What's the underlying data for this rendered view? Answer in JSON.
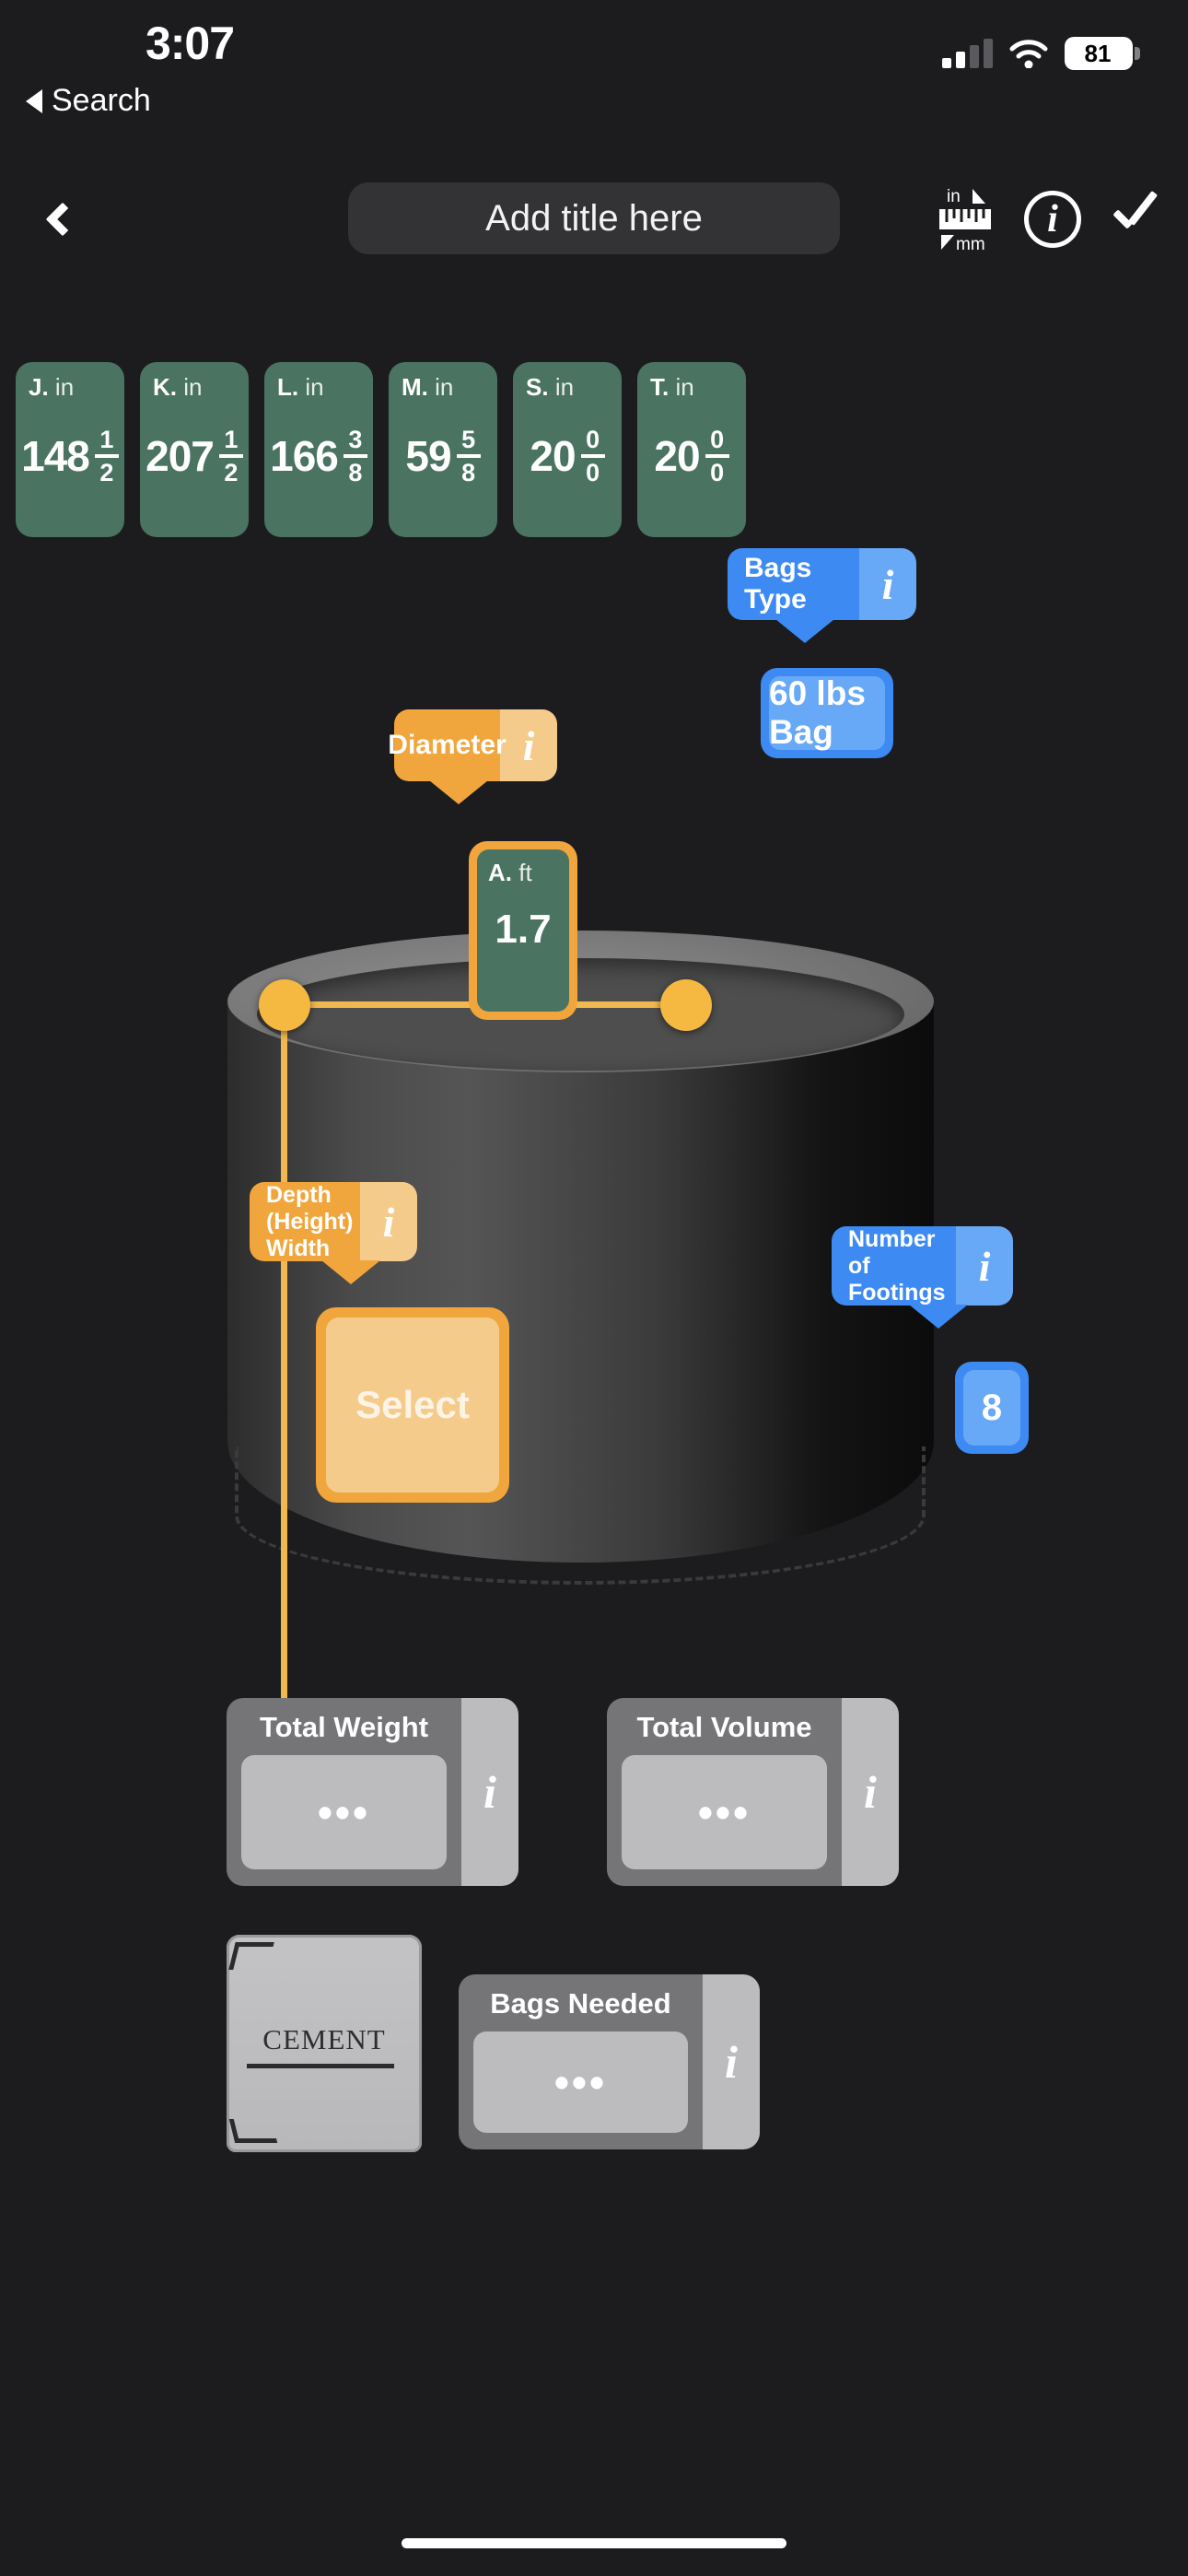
{
  "status_bar": {
    "time": "3:07",
    "battery_percent": "81",
    "back_to_app": "Search",
    "icons": [
      "signal-icon",
      "wifi-icon",
      "battery-icon"
    ]
  },
  "nav_bar": {
    "back_icon": "chevron-left-icon",
    "title_placeholder": "Add title here",
    "unit_toggle_icon": "ruler-in-mm-icon",
    "unit_toggle_top": "in",
    "unit_toggle_bottom": "mm",
    "info_icon": "info-circle-icon",
    "confirm_icon": "checkmark-icon"
  },
  "measurement_chips": [
    {
      "letter": "J.",
      "unit": "in",
      "whole": "148",
      "num": "1",
      "den": "2"
    },
    {
      "letter": "K.",
      "unit": "in",
      "whole": "207",
      "num": "1",
      "den": "2"
    },
    {
      "letter": "L.",
      "unit": "in",
      "whole": "166",
      "num": "3",
      "den": "8"
    },
    {
      "letter": "M.",
      "unit": "in",
      "whole": "59",
      "num": "5",
      "den": "8"
    },
    {
      "letter": "S.",
      "unit": "in",
      "whole": "20",
      "num": "0",
      "den": "0"
    },
    {
      "letter": "T.",
      "unit": "in",
      "whole": "20",
      "num": "0",
      "den": "0"
    }
  ],
  "bags_type": {
    "label": "Bags Type",
    "info_icon": "info-italic-icon",
    "value": "60 lbs Bag"
  },
  "diameter": {
    "label": "Diameter",
    "info_icon": "info-italic-icon",
    "chip_letter": "A.",
    "chip_unit": "ft",
    "chip_value": "1.7"
  },
  "depth_width": {
    "label": "Depth (Height) Width",
    "info_icon": "info-italic-icon",
    "button_label": "Select"
  },
  "footings": {
    "label": "Number of Footings",
    "info_icon": "info-italic-icon",
    "value": "8"
  },
  "results": [
    {
      "label": "Total Weight",
      "value": "•••",
      "info_icon": "info-italic-icon"
    },
    {
      "label": "Total Volume",
      "value": "•••",
      "info_icon": "info-italic-icon"
    },
    {
      "label": "Bags Needed",
      "value": "•••",
      "info_icon": "info-italic-icon"
    }
  ],
  "cement_bag": {
    "word": "CEMENT"
  },
  "colors": {
    "background": "#1c1c1e",
    "green_chip": "#4a7362",
    "blue": "#3d8bf2",
    "blue_light": "#67a8f7",
    "orange": "#f0a63c",
    "orange_light": "#f5cb8b",
    "handle": "#f5b840",
    "grey_card": "#757578",
    "grey_field": "#bcbcbe"
  }
}
